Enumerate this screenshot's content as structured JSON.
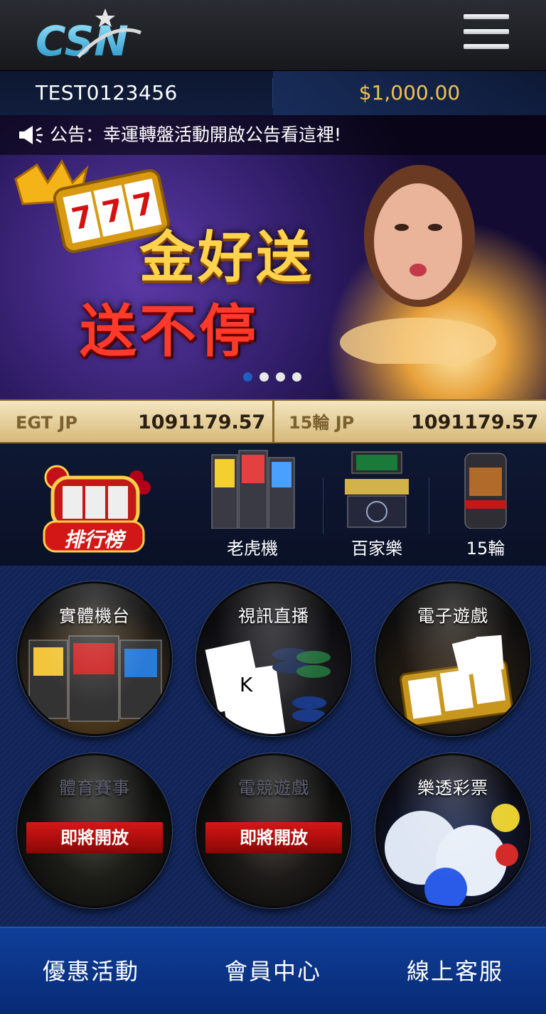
{
  "header": {
    "logo_text": "CSN",
    "menu_icon": "hamburger-menu-icon"
  },
  "account": {
    "username": "TEST0123456",
    "balance": "$1,000.00"
  },
  "announcement": {
    "icon": "megaphone-icon",
    "text": "公告：幸運轉盤活動開啟公告看這裡!"
  },
  "banner": {
    "headline_1": "金好送",
    "headline_2": "送不停",
    "slide_count": 4,
    "active_slide": 1
  },
  "jackpots": [
    {
      "label": "EGT JP",
      "value": "1091179.57"
    },
    {
      "label": "15輪 JP",
      "value": "1091179.57"
    }
  ],
  "categories": {
    "ranking_label": "排行榜",
    "items": [
      {
        "label": "老虎機"
      },
      {
        "label": "百家樂"
      },
      {
        "label": "15輪"
      }
    ]
  },
  "games": [
    {
      "title": "實體機台",
      "status": ""
    },
    {
      "title": "視訊直播",
      "status": ""
    },
    {
      "title": "電子遊戲",
      "status": ""
    },
    {
      "title": "體育賽事",
      "status": "即將開放"
    },
    {
      "title": "電競遊戲",
      "status": "即將開放"
    },
    {
      "title": "樂透彩票",
      "status": ""
    }
  ],
  "bottom_nav": [
    {
      "label": "優惠活動"
    },
    {
      "label": "會員中心"
    },
    {
      "label": "線上客服"
    }
  ],
  "colors": {
    "balance": "#f2c34b",
    "nav_bg": "#0f3f9a",
    "jackpot_bg": "#e8d3a0",
    "coming_soon": "#c81010"
  }
}
